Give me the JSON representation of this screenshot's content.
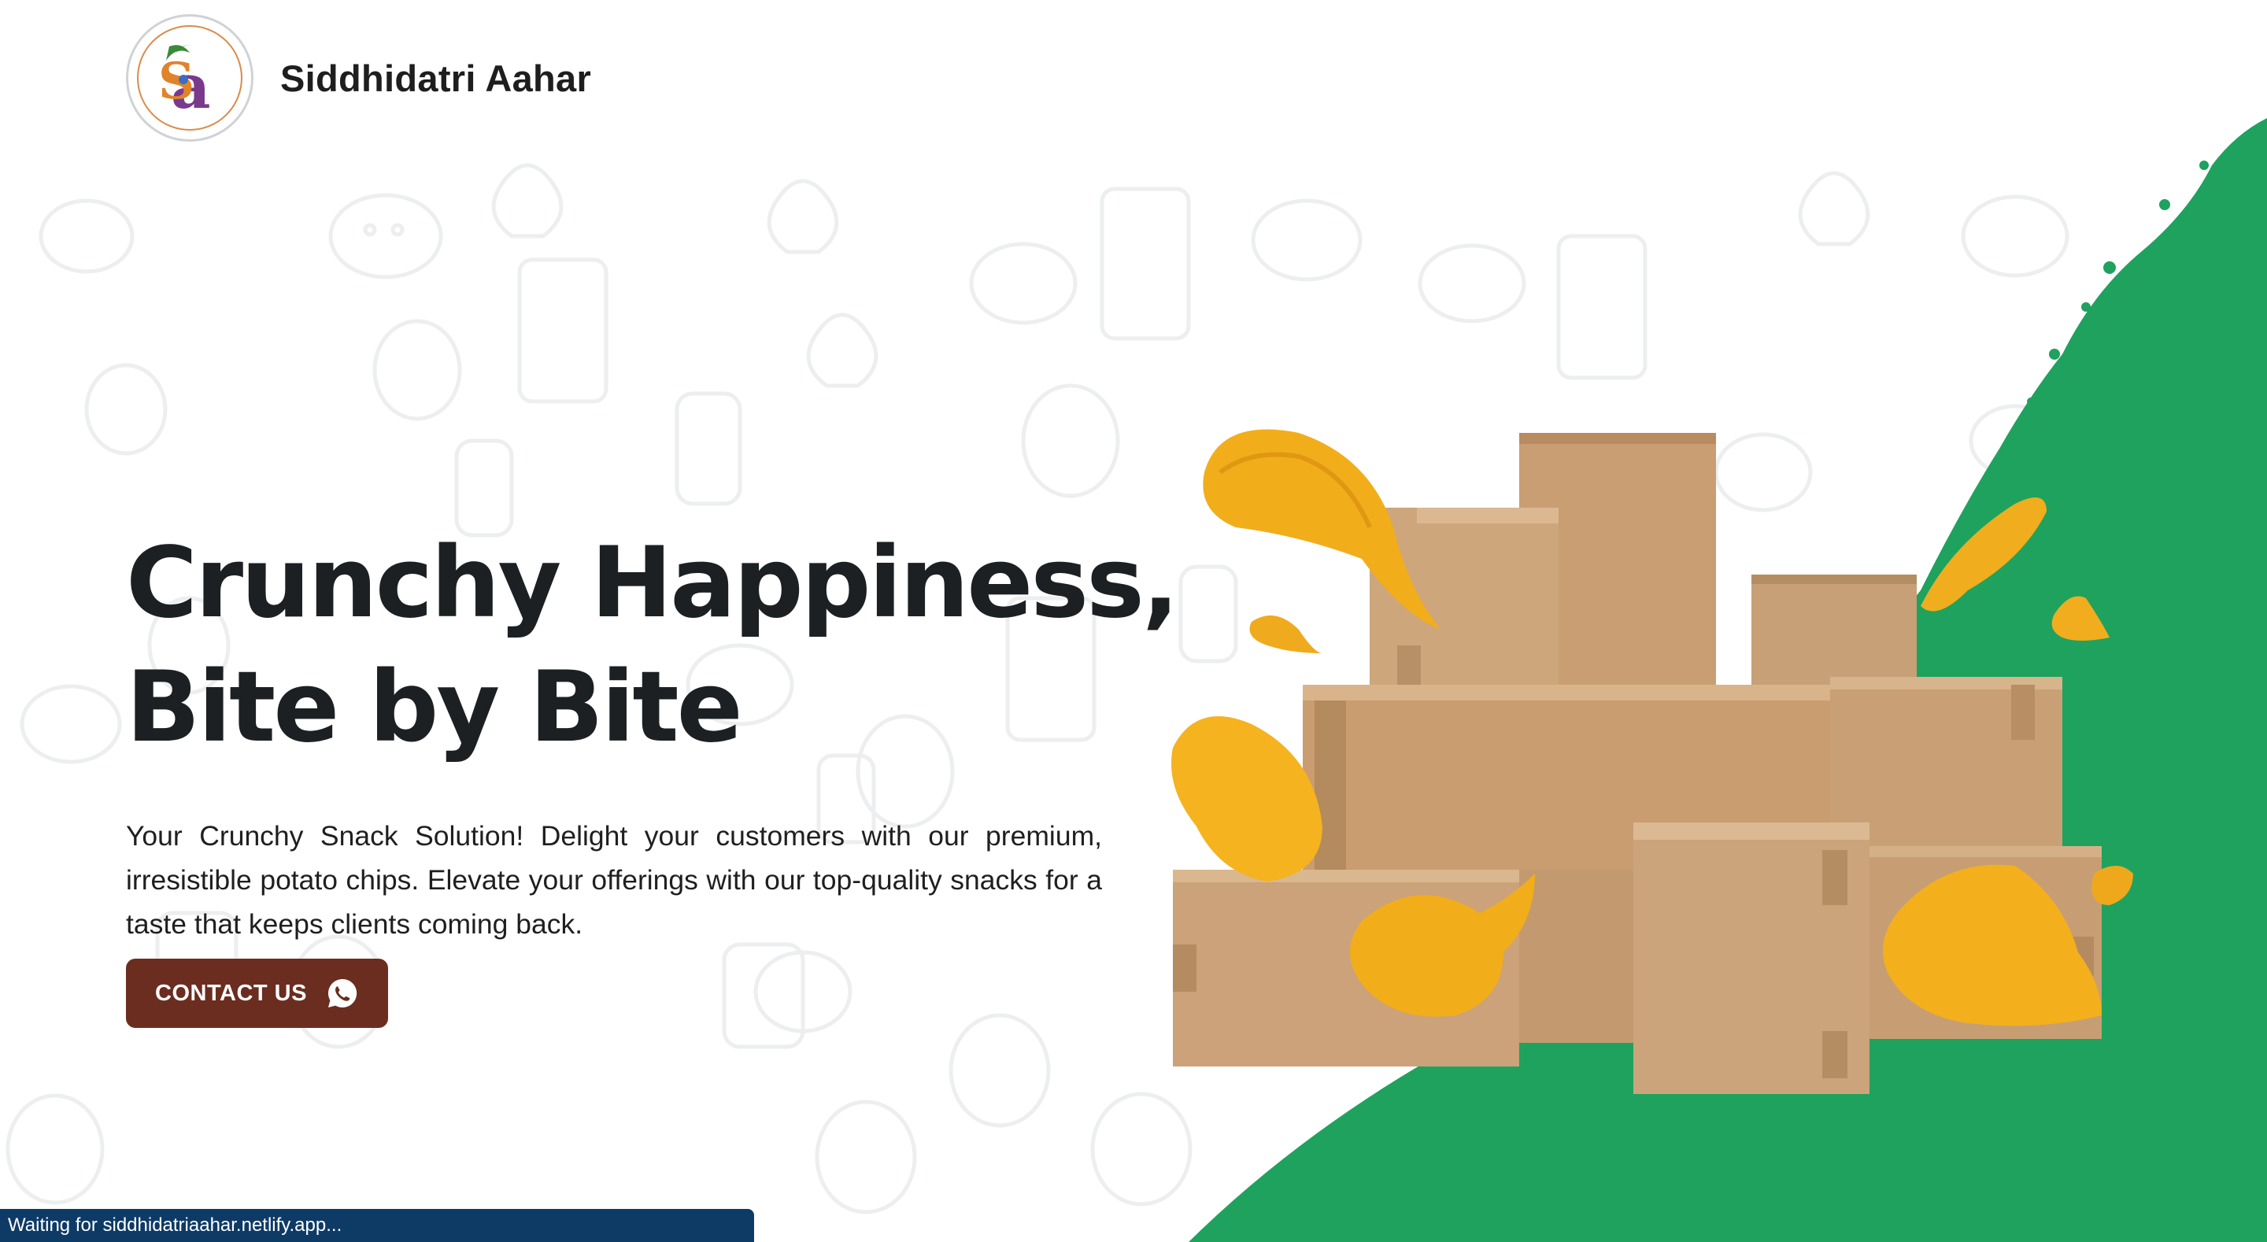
{
  "header": {
    "brand_name": "Siddhidatri Aahar",
    "logo_icon": "siddhidatri-logo-icon"
  },
  "hero": {
    "title_line1": "Crunchy Happiness,",
    "title_line2": "Bite by Bite",
    "description": "Your Crunchy Snack Solution! Delight your customers with our premium, irresistible potato chips. Elevate your offerings with our top-quality snacks for a taste that keeps clients coming back.",
    "contact_label": "CONTACT US",
    "contact_icon": "whatsapp-icon",
    "art_icon": "boxes-with-chips-illustration"
  },
  "status_bar": {
    "text": "Waiting for siddhidatriaahar.netlify.app..."
  },
  "colors": {
    "background": "#ffffff",
    "title": "#1d2022",
    "button": "#6b2d1f",
    "accent_green": "#1ea25e",
    "box_brown": "#c8a27a",
    "chip_yellow": "#f5b51c",
    "status_bar": "#0e3a66"
  }
}
